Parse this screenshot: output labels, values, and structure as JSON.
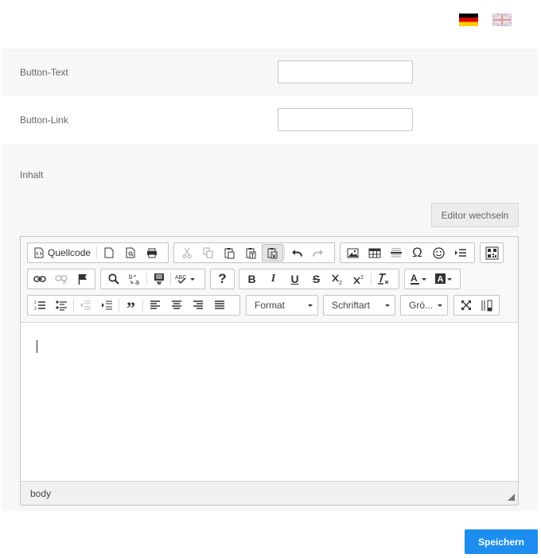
{
  "languages": [
    {
      "name": "Deutsch",
      "icon": "flag-de-icon"
    },
    {
      "name": "English",
      "icon": "flag-uk-icon"
    }
  ],
  "fields": {
    "button_text_label": "Button-Text",
    "button_text_value": "",
    "button_link_label": "Button-Link",
    "button_link_value": "",
    "content_label": "Inhalt"
  },
  "editor": {
    "switch_label": "Editor wechseln",
    "source_label": "Quellcode",
    "format_label": "Format",
    "font_label": "Schriftart",
    "size_label": "Grö...",
    "path_text": "body"
  },
  "actions": {
    "save_label": "Speichern"
  },
  "colors": {
    "accent": "#1d8ef0",
    "panel": "#f7f7f7"
  }
}
